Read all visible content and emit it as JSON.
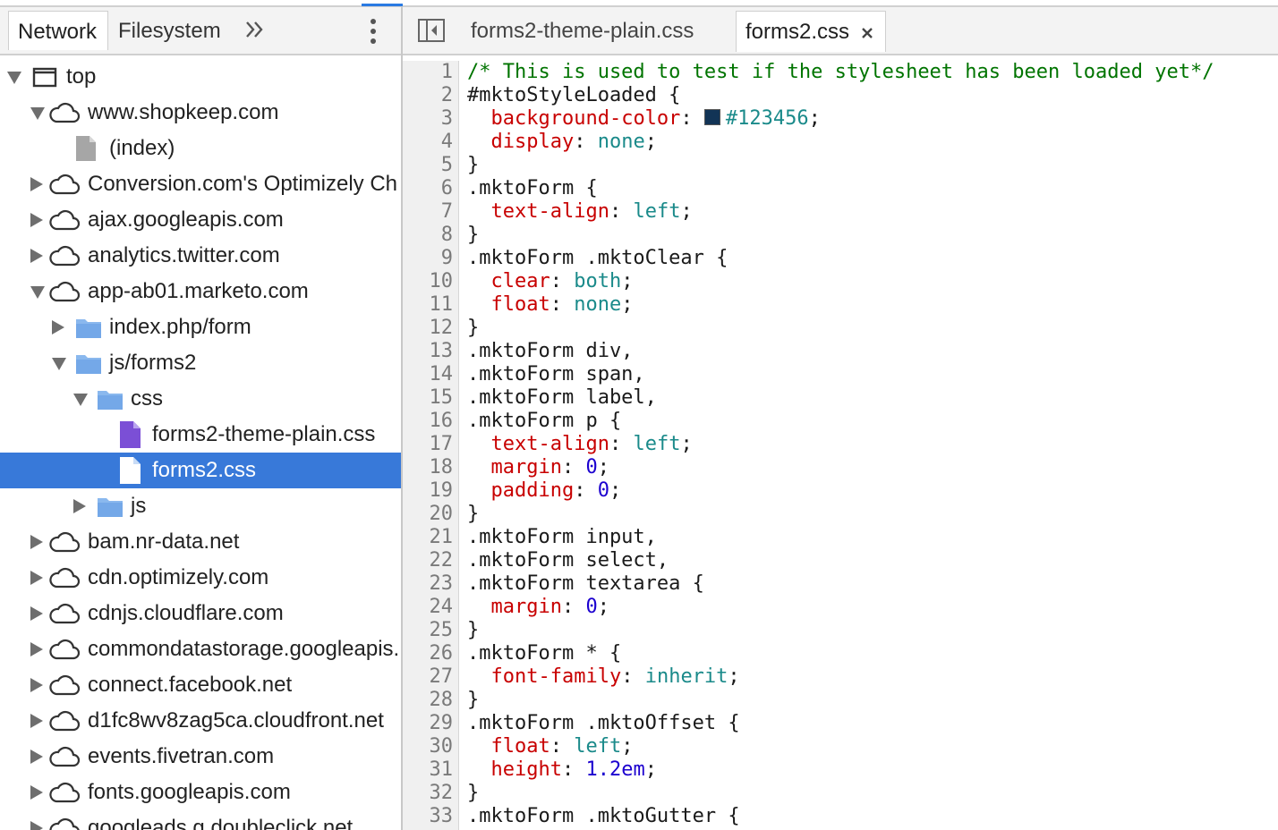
{
  "navigator": {
    "tabs": [
      {
        "label": "Network"
      },
      {
        "label": "Filesystem"
      }
    ],
    "tree": [
      {
        "label": "top",
        "icon": "frame-icon",
        "expanded": true,
        "depth": 0
      },
      {
        "label": "www.shopkeep.com",
        "icon": "cloud-icon",
        "expanded": true,
        "depth": 1
      },
      {
        "label": "(index)",
        "icon": "document-icon",
        "depth": 2
      },
      {
        "label": "Conversion.com's Optimizely Ch",
        "icon": "cloud-icon",
        "expanded": false,
        "depth": 1
      },
      {
        "label": "ajax.googleapis.com",
        "icon": "cloud-icon",
        "expanded": false,
        "depth": 1
      },
      {
        "label": "analytics.twitter.com",
        "icon": "cloud-icon",
        "expanded": false,
        "depth": 1
      },
      {
        "label": "app-ab01.marketo.com",
        "icon": "cloud-icon",
        "expanded": true,
        "depth": 1
      },
      {
        "label": "index.php/form",
        "icon": "folder-icon",
        "expanded": false,
        "depth": 2
      },
      {
        "label": "js/forms2",
        "icon": "folder-icon",
        "expanded": true,
        "depth": 2
      },
      {
        "label": "css",
        "icon": "folder-icon",
        "expanded": true,
        "depth": 3
      },
      {
        "label": "forms2-theme-plain.css",
        "icon": "stylesheet-icon",
        "depth": 4
      },
      {
        "label": "forms2.css",
        "icon": "stylesheet-icon",
        "depth": 4,
        "selected": true
      },
      {
        "label": "js",
        "icon": "folder-icon",
        "expanded": false,
        "depth": 3
      },
      {
        "label": "bam.nr-data.net",
        "icon": "cloud-icon",
        "expanded": false,
        "depth": 1
      },
      {
        "label": "cdn.optimizely.com",
        "icon": "cloud-icon",
        "expanded": false,
        "depth": 1
      },
      {
        "label": "cdnjs.cloudflare.com",
        "icon": "cloud-icon",
        "expanded": false,
        "depth": 1
      },
      {
        "label": "commondatastorage.googleapis.",
        "icon": "cloud-icon",
        "expanded": false,
        "depth": 1
      },
      {
        "label": "connect.facebook.net",
        "icon": "cloud-icon",
        "expanded": false,
        "depth": 1
      },
      {
        "label": "d1fc8wv8zag5ca.cloudfront.net",
        "icon": "cloud-icon",
        "expanded": false,
        "depth": 1
      },
      {
        "label": "events.fivetran.com",
        "icon": "cloud-icon",
        "expanded": false,
        "depth": 1
      },
      {
        "label": "fonts.googleapis.com",
        "icon": "cloud-icon",
        "expanded": false,
        "depth": 1
      },
      {
        "label": "googleads.g.doubleclick.net",
        "icon": "cloud-icon",
        "expanded": false,
        "depth": 1
      }
    ]
  },
  "editor": {
    "tabs": [
      {
        "label": "forms2-theme-plain.css"
      },
      {
        "label": "forms2.css",
        "active": true,
        "closable": true
      }
    ],
    "colors": {
      "swatch": "#123456"
    },
    "lines": [
      [
        [
          "t-comment",
          "/* This is used to test if the stylesheet has been loaded yet*/"
        ]
      ],
      [
        [
          "t-selector",
          "#mktoStyleLoaded {"
        ]
      ],
      [
        [
          "t-punct",
          "  "
        ],
        [
          "t-prop",
          "background-color"
        ],
        [
          "t-punct",
          ": "
        ],
        [
          "swatch",
          "#123456"
        ],
        [
          "t-value",
          "#123456"
        ],
        [
          "t-punct",
          ";"
        ]
      ],
      [
        [
          "t-punct",
          "  "
        ],
        [
          "t-prop",
          "display"
        ],
        [
          "t-punct",
          ": "
        ],
        [
          "t-value",
          "none"
        ],
        [
          "t-punct",
          ";"
        ]
      ],
      [
        [
          "t-punct",
          "}"
        ]
      ],
      [
        [
          "t-selector",
          ".mktoForm {"
        ]
      ],
      [
        [
          "t-punct",
          "  "
        ],
        [
          "t-prop",
          "text-align"
        ],
        [
          "t-punct",
          ": "
        ],
        [
          "t-value",
          "left"
        ],
        [
          "t-punct",
          ";"
        ]
      ],
      [
        [
          "t-punct",
          "}"
        ]
      ],
      [
        [
          "t-selector",
          ".mktoForm .mktoClear {"
        ]
      ],
      [
        [
          "t-punct",
          "  "
        ],
        [
          "t-prop",
          "clear"
        ],
        [
          "t-punct",
          ": "
        ],
        [
          "t-value",
          "both"
        ],
        [
          "t-punct",
          ";"
        ]
      ],
      [
        [
          "t-punct",
          "  "
        ],
        [
          "t-prop",
          "float"
        ],
        [
          "t-punct",
          ": "
        ],
        [
          "t-value",
          "none"
        ],
        [
          "t-punct",
          ";"
        ]
      ],
      [
        [
          "t-punct",
          "}"
        ]
      ],
      [
        [
          "t-selector",
          ".mktoForm div,"
        ]
      ],
      [
        [
          "t-selector",
          ".mktoForm span,"
        ]
      ],
      [
        [
          "t-selector",
          ".mktoForm label,"
        ]
      ],
      [
        [
          "t-selector",
          ".mktoForm p {"
        ]
      ],
      [
        [
          "t-punct",
          "  "
        ],
        [
          "t-prop",
          "text-align"
        ],
        [
          "t-punct",
          ": "
        ],
        [
          "t-value",
          "left"
        ],
        [
          "t-punct",
          ";"
        ]
      ],
      [
        [
          "t-punct",
          "  "
        ],
        [
          "t-prop",
          "margin"
        ],
        [
          "t-punct",
          ": "
        ],
        [
          "t-number",
          "0"
        ],
        [
          "t-punct",
          ";"
        ]
      ],
      [
        [
          "t-punct",
          "  "
        ],
        [
          "t-prop",
          "padding"
        ],
        [
          "t-punct",
          ": "
        ],
        [
          "t-number",
          "0"
        ],
        [
          "t-punct",
          ";"
        ]
      ],
      [
        [
          "t-punct",
          "}"
        ]
      ],
      [
        [
          "t-selector",
          ".mktoForm input,"
        ]
      ],
      [
        [
          "t-selector",
          ".mktoForm select,"
        ]
      ],
      [
        [
          "t-selector",
          ".mktoForm textarea {"
        ]
      ],
      [
        [
          "t-punct",
          "  "
        ],
        [
          "t-prop",
          "margin"
        ],
        [
          "t-punct",
          ": "
        ],
        [
          "t-number",
          "0"
        ],
        [
          "t-punct",
          ";"
        ]
      ],
      [
        [
          "t-punct",
          "}"
        ]
      ],
      [
        [
          "t-selector",
          ".mktoForm * {"
        ]
      ],
      [
        [
          "t-punct",
          "  "
        ],
        [
          "t-prop",
          "font-family"
        ],
        [
          "t-punct",
          ": "
        ],
        [
          "t-value",
          "inherit"
        ],
        [
          "t-punct",
          ";"
        ]
      ],
      [
        [
          "t-punct",
          "}"
        ]
      ],
      [
        [
          "t-selector",
          ".mktoForm .mktoOffset {"
        ]
      ],
      [
        [
          "t-punct",
          "  "
        ],
        [
          "t-prop",
          "float"
        ],
        [
          "t-punct",
          ": "
        ],
        [
          "t-value",
          "left"
        ],
        [
          "t-punct",
          ";"
        ]
      ],
      [
        [
          "t-punct",
          "  "
        ],
        [
          "t-prop",
          "height"
        ],
        [
          "t-punct",
          ": "
        ],
        [
          "t-number",
          "1.2em"
        ],
        [
          "t-punct",
          ";"
        ]
      ],
      [
        [
          "t-punct",
          "}"
        ]
      ],
      [
        [
          "t-selector",
          ".mktoForm .mktoGutter {"
        ]
      ]
    ]
  }
}
